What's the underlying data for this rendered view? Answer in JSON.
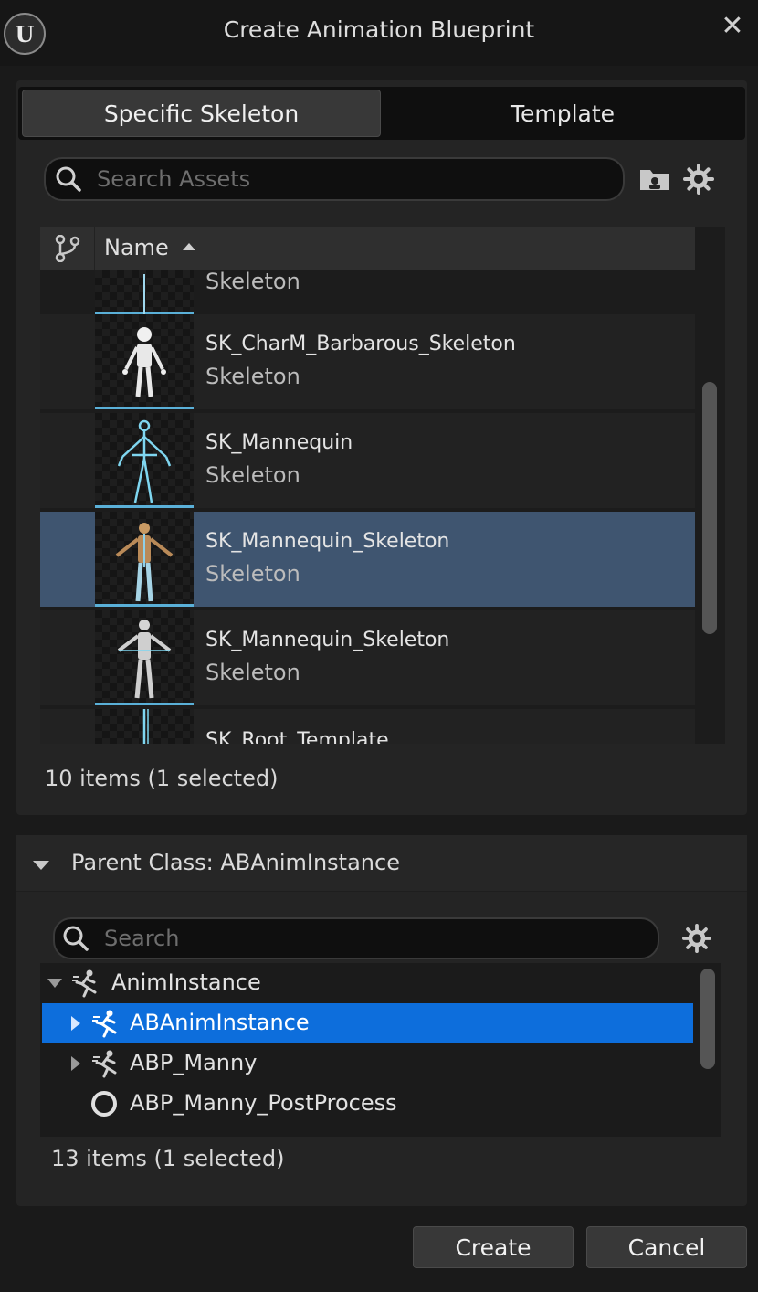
{
  "window": {
    "title": "Create Animation Blueprint",
    "logo_icon": "unreal-engine-logo",
    "logo_text": "U",
    "close_glyph": "✕"
  },
  "tabs": [
    {
      "label": "Specific Skeleton",
      "active": true
    },
    {
      "label": "Template",
      "active": false
    }
  ],
  "asset_search": {
    "placeholder": "Search Assets",
    "value": ""
  },
  "asset_list": {
    "column_name": "Name",
    "sort": "ascending",
    "rows": [
      {
        "name": "",
        "type": "Skeleton",
        "partial": true,
        "selected": false
      },
      {
        "name": "SK_CharM_Barbarous_Skeleton",
        "type": "Skeleton",
        "selected": false,
        "thumb": "white-skeleton"
      },
      {
        "name": "SK_Mannequin",
        "type": "Skeleton",
        "selected": false,
        "thumb": "blue-wire-mannequin"
      },
      {
        "name": "SK_Mannequin_Skeleton",
        "type": "Skeleton",
        "selected": true,
        "thumb": "orange-mannequin"
      },
      {
        "name": "SK_Mannequin_Skeleton",
        "type": "Skeleton",
        "selected": false,
        "thumb": "grey-mannequin"
      },
      {
        "name": "SK_Root_Template",
        "type": "",
        "partial": true,
        "selected": false,
        "thumb": "root-bone"
      }
    ],
    "count_text": "10 items (1 selected)"
  },
  "parent_class": {
    "header": "Parent Class: ABAnimInstance",
    "search_placeholder": "Search",
    "tree": [
      {
        "label": "AnimInstance",
        "expanded": true,
        "icon": "anim-runner-icon"
      },
      {
        "label": "ABAnimInstance",
        "selected": true,
        "icon": "anim-runner-icon"
      },
      {
        "label": "ABP_Manny",
        "icon": "anim-runner-icon"
      },
      {
        "label": "ABP_Manny_PostProcess",
        "icon": "circle-ring-icon"
      }
    ],
    "count_text": "13 items (1 selected)"
  },
  "buttons": {
    "create": "Create",
    "cancel": "Cancel"
  },
  "colors": {
    "selection_row": "#3f5570",
    "tree_selection": "#0d6edc",
    "thumb_underline": "#5ab0d8"
  }
}
